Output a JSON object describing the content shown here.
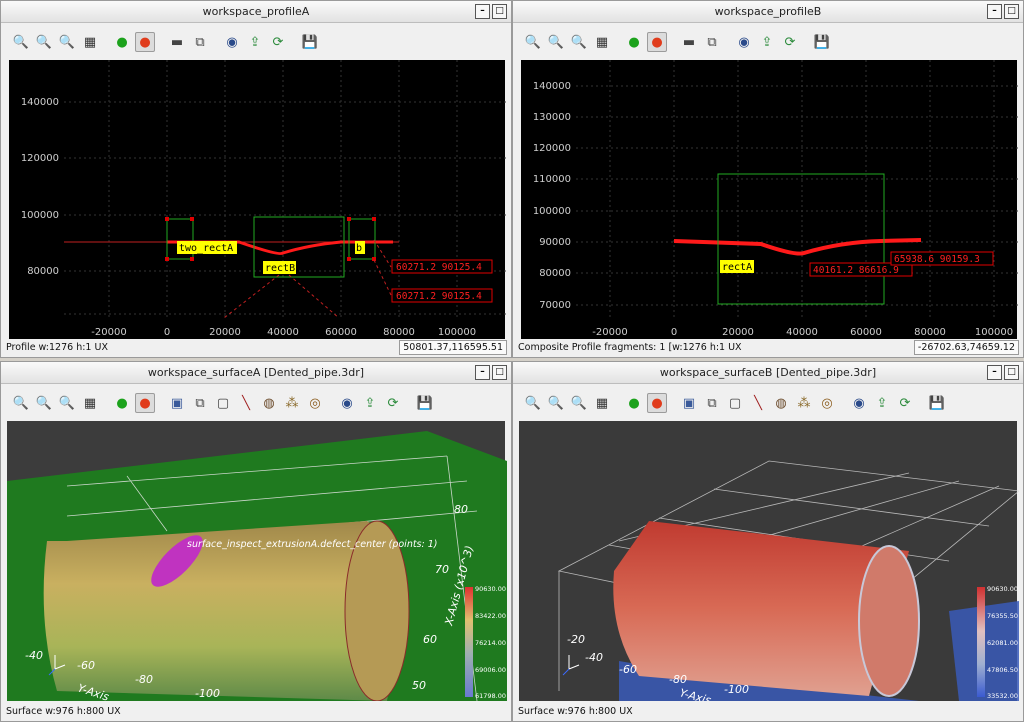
{
  "panes": {
    "profileA": {
      "title": "workspace_profileA",
      "status": "Profile w:1276 h:1 UX",
      "coord": "50801.37,116595.51",
      "y_ticks": [
        "140000",
        "120000",
        "100000",
        "80000"
      ],
      "x_ticks": [
        "-20000",
        "0",
        "20000",
        "40000",
        "60000",
        "80000",
        "100000"
      ],
      "labels": {
        "two_rectA": "two_rectA",
        "rectB": "rectB",
        "b": "b",
        "m1": "60271.2 90125.4",
        "m2": "60271.2 90125.4"
      }
    },
    "profileB": {
      "title": "workspace_profileB",
      "status": "Composite Profile fragments: 1 [w:1276 h:1 UX",
      "coord": "-26702.63,74659.12",
      "y_ticks": [
        "140000",
        "130000",
        "120000",
        "110000",
        "100000",
        "90000",
        "80000",
        "70000"
      ],
      "x_ticks": [
        "-20000",
        "0",
        "20000",
        "40000",
        "60000",
        "80000",
        "100000"
      ],
      "labels": {
        "rectA": "rectA",
        "m1": "40161.2 86616.9",
        "m2": "65938.6 90159.3"
      }
    },
    "surfaceA": {
      "title": "workspace_surfaceA [Dented_pipe.3dr]",
      "status": "Surface w:976 h:800 UX",
      "annotation": "surface_inspect_extrusionA.defect_center (points: 1)",
      "axis_label": "X-Axis (x10^3)",
      "y_axis_label": "Y-Axis",
      "axis_numbers": [
        "80",
        "70",
        "60",
        "50",
        "-40",
        "-60",
        "-80",
        "-100"
      ],
      "colorbar": [
        "90630.00",
        "83422.00",
        "76214.00",
        "69006.00",
        "61798.00"
      ]
    },
    "surfaceB": {
      "title": "workspace_surfaceB [Dented_pipe.3dr]",
      "status": "Surface w:976 h:800 UX",
      "y_axis_label": "Y-Axis",
      "axis_numbers": [
        "-20",
        "-40",
        "-60",
        "-80",
        "-100"
      ],
      "colorbar": [
        "90630.00",
        "76355.50",
        "62081.00",
        "47806.50",
        "33532.00"
      ]
    }
  },
  "toolbar_icons_profile": [
    "zoom-out-icon",
    "zoom-in-icon",
    "zoom-fit-icon",
    "grid-icon",
    "green-dot-icon",
    "record-icon",
    "rect-icon",
    "tiles-icon",
    "inspect-icon",
    "export-icon",
    "refresh-icon",
    "save-icon"
  ],
  "colors": {
    "profile_line": "#ff1a1a",
    "rect": "#22aa22",
    "label_bg": "#ffff00",
    "marker": "#e00000"
  }
}
